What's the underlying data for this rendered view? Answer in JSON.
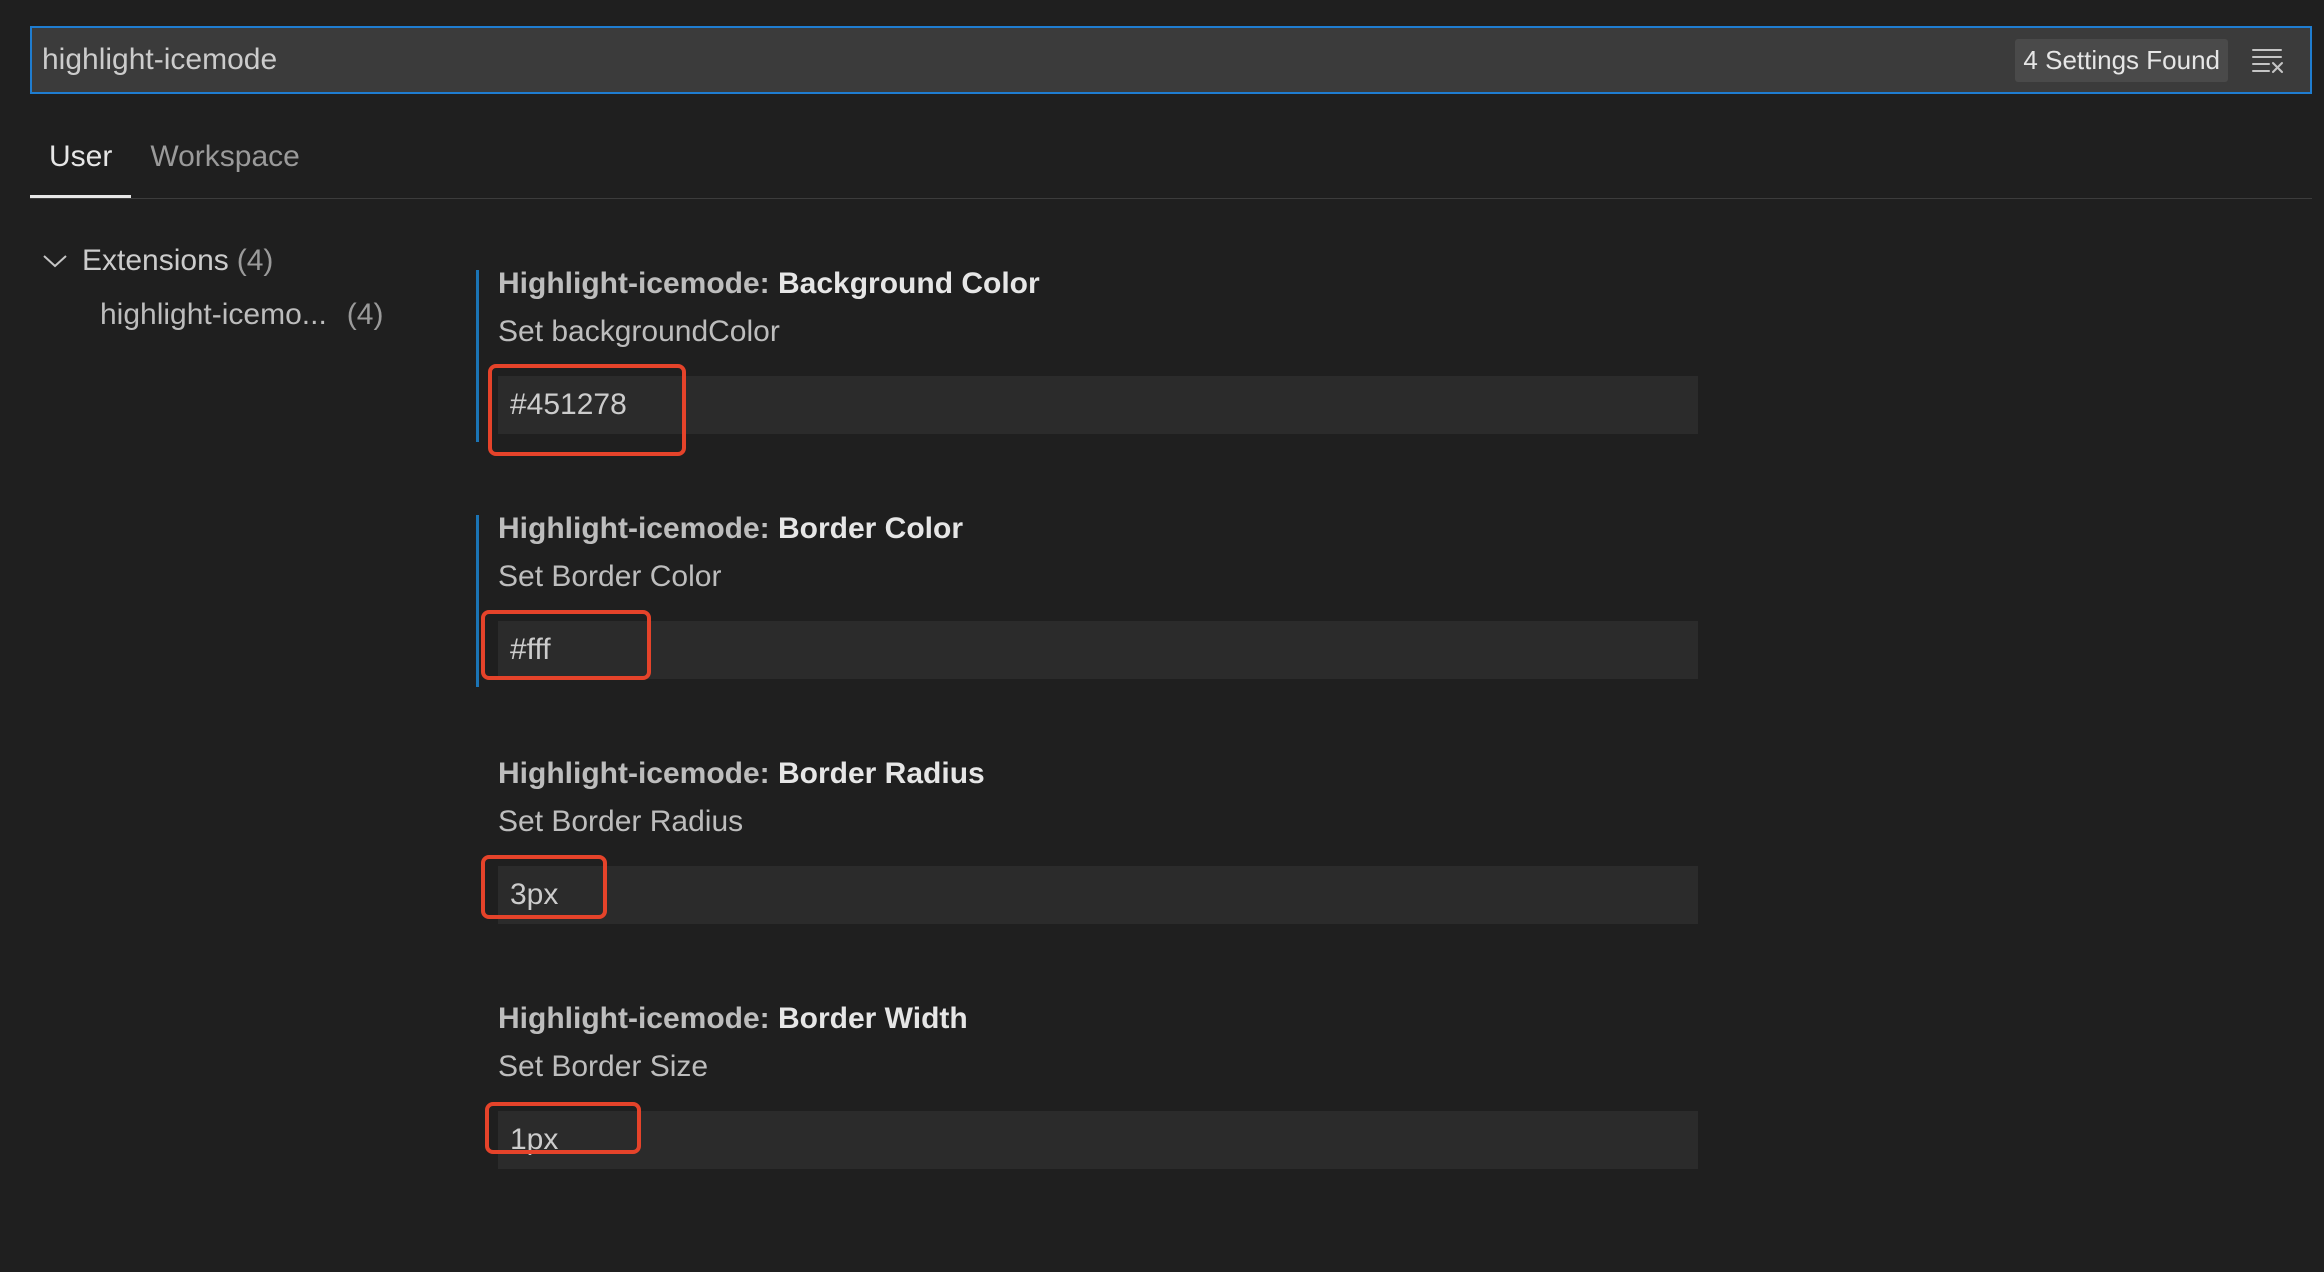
{
  "search": {
    "value": "highlight-icemode",
    "results_label": "4 Settings Found",
    "clear_icon": "clear-filter-icon"
  },
  "tabs": [
    {
      "label": "User",
      "active": true
    },
    {
      "label": "Workspace",
      "active": false
    }
  ],
  "toc": {
    "group_label": "Extensions",
    "group_count": "(4)",
    "items": [
      {
        "label": "highlight-icemo...",
        "count": "(4)"
      }
    ]
  },
  "settings": [
    {
      "category": "Highlight-icemode: ",
      "name": "Background Color",
      "description": "Set backgroundColor",
      "value": "#451278",
      "modified": true
    },
    {
      "category": "Highlight-icemode: ",
      "name": "Border Color",
      "description": "Set Border Color",
      "value": "#fff",
      "modified": true
    },
    {
      "category": "Highlight-icemode: ",
      "name": "Border Radius",
      "description": "Set Border Radius",
      "value": "3px",
      "modified": false
    },
    {
      "category": "Highlight-icemode: ",
      "name": "Border Width",
      "description": "Set Border Size",
      "value": "1px",
      "modified": false
    }
  ],
  "colors": {
    "focus_border": "#1f7dd0",
    "modified_indicator": "#1b74b5",
    "annotation_red": "#e5432a",
    "background": "#1f1f1f",
    "input_background": "#2b2b2b"
  }
}
